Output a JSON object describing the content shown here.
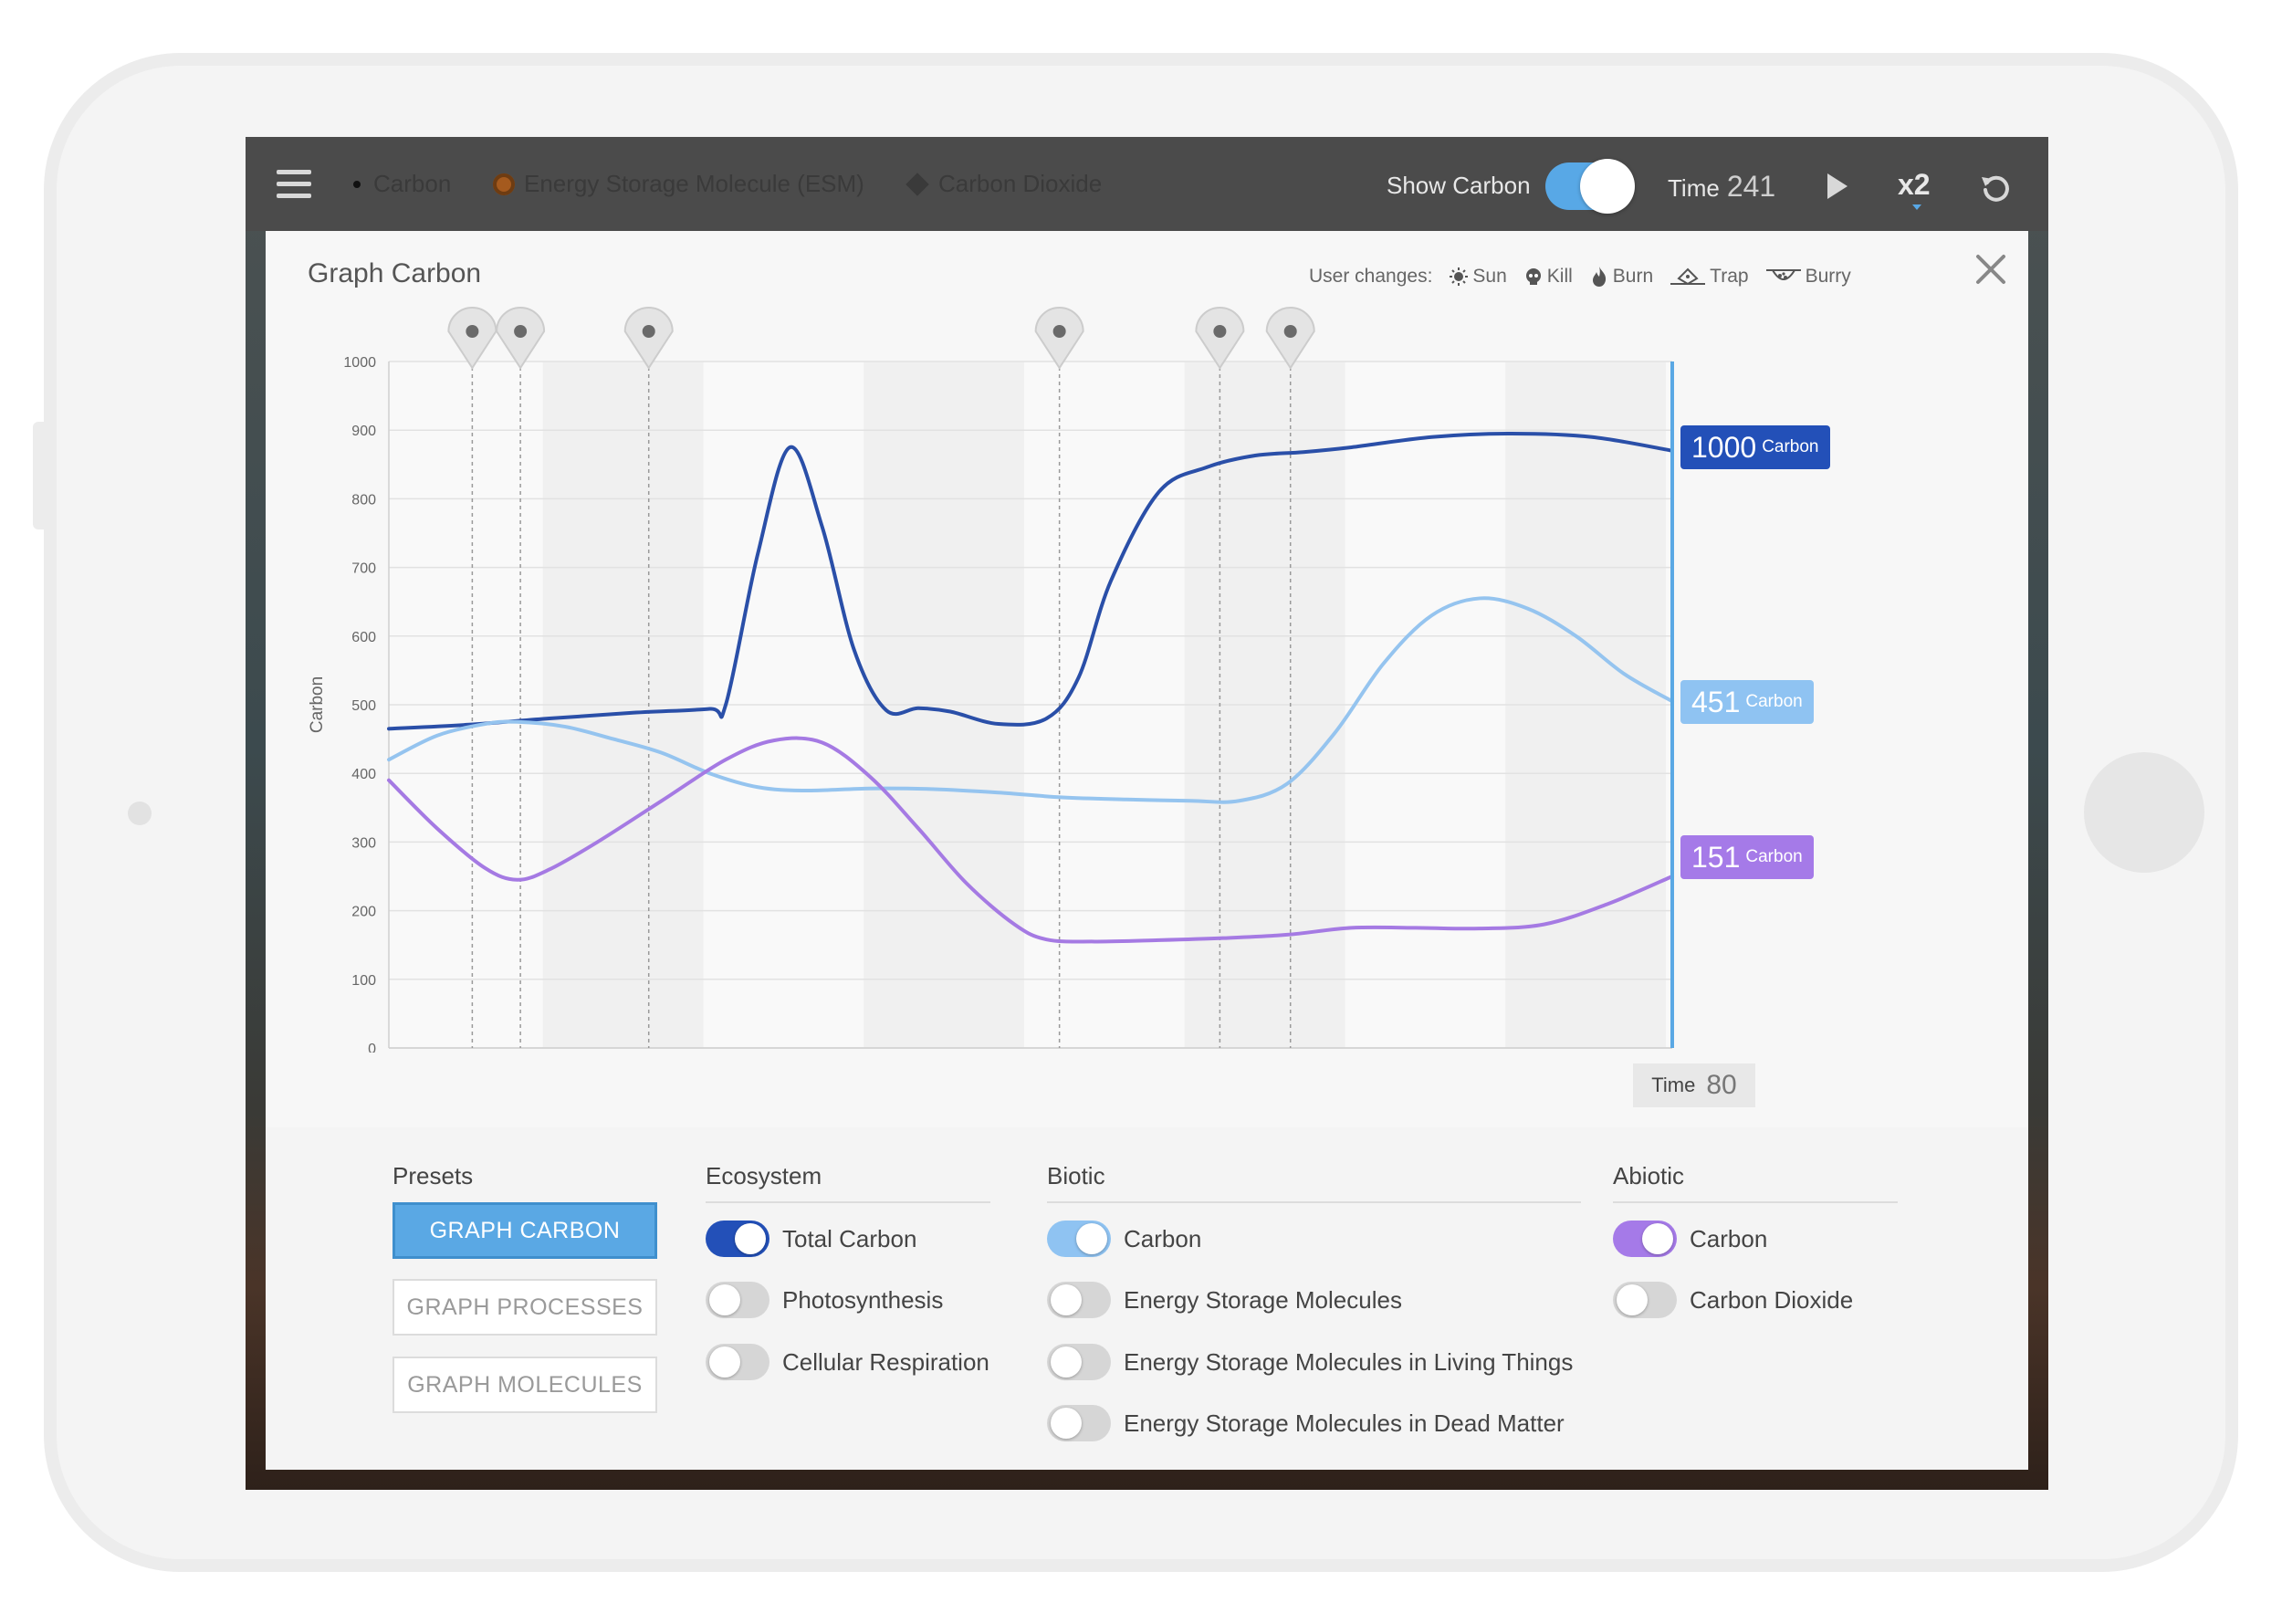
{
  "topbar": {
    "legend": {
      "carbon": "Carbon",
      "esm": "Energy Storage Molecule (ESM)",
      "co2": "Carbon Dioxide"
    },
    "show_carbon_label": "Show Carbon",
    "show_carbon_on": true,
    "time_label": "Time",
    "time_value": "241",
    "speed_label": "x2"
  },
  "panel": {
    "title": "Graph Carbon",
    "user_changes": {
      "label": "User changes:",
      "items": [
        "Sun",
        "Kill",
        "Burn",
        "Trap",
        "Burry"
      ]
    },
    "time_label": "Time",
    "time_value": "80",
    "tags": [
      {
        "value": "1000",
        "unit": "Carbon",
        "color": "#2350b8"
      },
      {
        "value": "451",
        "unit": "Carbon",
        "color": "#8fc3f2"
      },
      {
        "value": "151",
        "unit": "Carbon",
        "color": "#a57ae8"
      }
    ],
    "markers": [
      {
        "label": "−☀",
        "t": 5.2
      },
      {
        "label": "+☀",
        "t": 8.2
      },
      {
        "label": "kill",
        "t": 16.2
      },
      {
        "label": "burn",
        "t": 41.8
      },
      {
        "label": "trap",
        "t": 51.8
      },
      {
        "label": "burry",
        "t": 56.2
      }
    ]
  },
  "chart_data": {
    "type": "line",
    "xlim": [
      0,
      80
    ],
    "ylim": [
      0,
      1000
    ],
    "x_ticks": [
      "10",
      "20",
      "30",
      "40",
      "50",
      "60",
      "70"
    ],
    "y_ticks": [
      "0",
      "100",
      "200",
      "300",
      "400",
      "500",
      "600",
      "700",
      "800",
      "900",
      "1000"
    ],
    "ylabel": "Carbon",
    "xlabel": "",
    "grid": true,
    "series": [
      {
        "name": "Total Carbon",
        "color": "#2a4fa8",
        "x": [
          0,
          5,
          10,
          15,
          20,
          21,
          23,
          25,
          27,
          29,
          31,
          33,
          35,
          38,
          41,
          43,
          45,
          48,
          51,
          54,
          57,
          60,
          65,
          70,
          75,
          80
        ],
        "y": [
          465,
          471,
          480,
          488,
          494,
          500,
          720,
          875,
          760,
          580,
          492,
          495,
          490,
          472,
          480,
          540,
          680,
          810,
          846,
          863,
          868,
          875,
          890,
          895,
          890,
          870
        ]
      },
      {
        "name": "Biotic Carbon",
        "color": "#95c4ef",
        "x": [
          0,
          3,
          6,
          8,
          11,
          14,
          17,
          20,
          23,
          26,
          30,
          34,
          38,
          42,
          46,
          50,
          53,
          56,
          59,
          62,
          65,
          68,
          71,
          74,
          77,
          80
        ],
        "y": [
          420,
          455,
          472,
          475,
          468,
          450,
          430,
          400,
          380,
          375,
          378,
          377,
          372,
          365,
          362,
          360,
          360,
          385,
          460,
          560,
          630,
          655,
          640,
          600,
          545,
          505
        ]
      },
      {
        "name": "Abiotic Carbon",
        "color": "#a57ae3",
        "x": [
          0,
          3,
          6,
          8,
          10,
          13,
          17,
          21,
          24,
          27,
          30,
          33,
          36,
          39,
          41,
          44,
          48,
          52,
          56,
          60,
          64,
          68,
          72,
          76,
          80
        ],
        "y": [
          390,
          320,
          262,
          245,
          260,
          300,
          360,
          420,
          448,
          445,
          395,
          320,
          240,
          180,
          158,
          155,
          157,
          160,
          165,
          175,
          175,
          174,
          180,
          210,
          250
        ]
      }
    ]
  },
  "controls": {
    "presets": {
      "heading": "Presets",
      "buttons": [
        "GRAPH CARBON",
        "GRAPH PROCESSES",
        "GRAPH MOLECULES"
      ]
    },
    "ecosystem": {
      "heading": "Ecosystem",
      "toggles": [
        {
          "label": "Total Carbon",
          "on": true,
          "color": "#2350b8"
        },
        {
          "label": "Photosynthesis",
          "on": false
        },
        {
          "label": "Cellular Respiration",
          "on": false
        }
      ]
    },
    "biotic": {
      "heading": "Biotic",
      "toggles": [
        {
          "label": "Carbon",
          "on": true,
          "color": "#8fc3f2"
        },
        {
          "label": "Energy Storage Molecules",
          "on": false
        },
        {
          "label": "Energy Storage Molecules in Living Things",
          "on": false
        },
        {
          "label": "Energy Storage Molecules in Dead Matter",
          "on": false
        }
      ]
    },
    "abiotic": {
      "heading": "Abiotic",
      "toggles": [
        {
          "label": "Carbon",
          "on": true,
          "color": "#a57ae8"
        },
        {
          "label": "Carbon Dioxide",
          "on": false
        }
      ]
    }
  }
}
